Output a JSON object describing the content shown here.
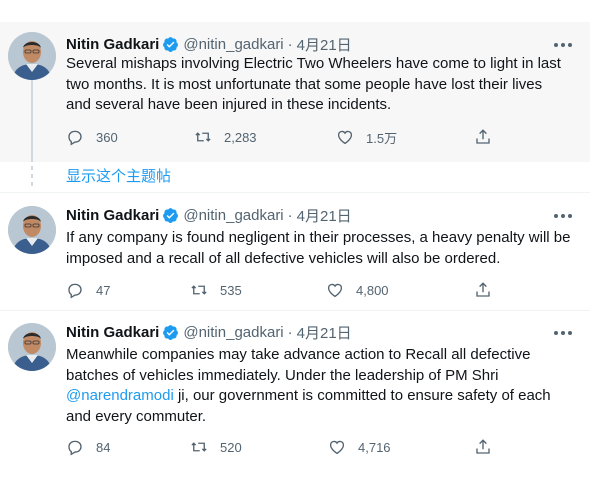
{
  "tweets": [
    {
      "author": "Nitin Gadkari",
      "handle": "@nitin_gadkari",
      "separator": "·",
      "date": "4月21日",
      "lines": [
        "Several mishaps involving Electric Two Wheelers have come to light in last",
        "two months. It is most unfortunate that some people have lost their lives",
        "and several have been injured in these incidents."
      ],
      "replies": "360",
      "retweets": "2,283",
      "likes": "1.5万"
    },
    {
      "author": "Nitin Gadkari",
      "handle": "@nitin_gadkari",
      "separator": "·",
      "date": "4月21日",
      "lines": [
        "If any company is found negligent in their processes, a heavy penalty will be",
        "imposed and a recall of all defective vehicles will also be ordered."
      ],
      "replies": "47",
      "retweets": "535",
      "likes": "4,800"
    },
    {
      "author": "Nitin Gadkari",
      "handle": "@nitin_gadkari",
      "separator": "·",
      "date": "4月21日",
      "lines": [
        "Meanwhile companies may take advance action to Recall all defective",
        "batches of vehicles immediately. Under the leadership of PM Shri"
      ],
      "mention": "@narendramodi",
      "line3_rest": " ji, our government is committed to ensure safety of each",
      "line4": "and every commuter.",
      "replies": "84",
      "retweets": "520",
      "likes": "4,716"
    }
  ],
  "show_thread_label": "显示这个主题帖",
  "icons": [
    "reply-icon",
    "retweet-icon",
    "like-icon",
    "share-icon",
    "verified-badge-icon",
    "more-options-icon"
  ],
  "colors": {
    "accent": "#1d9bf0",
    "muted": "#536471",
    "text": "#0f1419"
  }
}
